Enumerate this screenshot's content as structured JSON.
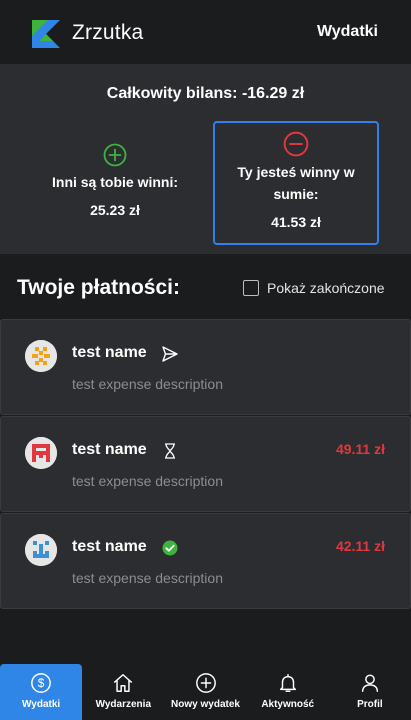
{
  "header": {
    "app_title": "Zrzutka",
    "page_label": "Wydatki"
  },
  "balance": {
    "total_label": "Całkowity bilans: -16.29 zł",
    "owed_to_you_label": "Inni są tobie winni:",
    "owed_to_you_amount": "25.23 zł",
    "you_owe_label": "Ty jesteś winny w sumie:",
    "you_owe_amount": "41.53 zł",
    "positive_color": "#3fb33f",
    "negative_color": "#e0383e"
  },
  "payments": {
    "title": "Twoje płatności:",
    "show_completed_label": "Pokaż zakończone",
    "show_completed_checked": false,
    "items": [
      {
        "name": "test name",
        "description": "test expense description",
        "amount": "",
        "status_icon": "send-icon"
      },
      {
        "name": "test name",
        "description": "test expense description",
        "amount": "49.11 zł",
        "status_icon": "hourglass-icon"
      },
      {
        "name": "test name",
        "description": "test expense description",
        "amount": "42.11 zł",
        "status_icon": "check-circle-icon"
      }
    ]
  },
  "nav": {
    "items": [
      {
        "label": "Wydatki",
        "icon": "dollar-circle-icon",
        "active": true
      },
      {
        "label": "Wydarzenia",
        "icon": "home-icon",
        "active": false
      },
      {
        "label": "Nowy wydatek",
        "icon": "plus-circle-icon",
        "active": false
      },
      {
        "label": "Aktywność",
        "icon": "bell-icon",
        "active": false
      },
      {
        "label": "Profil",
        "icon": "user-icon",
        "active": false
      }
    ],
    "active_color": "#2f86e6"
  }
}
